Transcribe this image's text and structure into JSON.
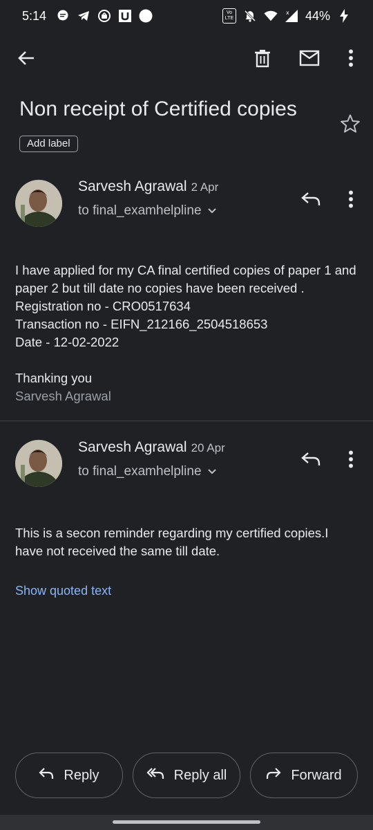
{
  "status_bar": {
    "time": "5:14",
    "battery": "44%",
    "lte_badge_top": "Vo",
    "lte_badge_bottom": "LTE"
  },
  "toolbar": {
    "back_icon": "arrow-left-icon",
    "delete_icon": "trash-icon",
    "mark_unread_icon": "mail-icon",
    "more_icon": "more-vert-icon"
  },
  "subject": "Non receipt of Certified copies",
  "add_label": "Add label",
  "messages": [
    {
      "sender": "Sarvesh Agrawal",
      "date": "2 Apr",
      "recipient": "to final_examhelpline",
      "body_lines": [
        "I have applied for my CA final certified copies of paper 1 and paper 2 but till date no copies have been received .",
        "Registration no - CRO0517634",
        "Transaction no - EIFN_212166_2504518653",
        "Date - 12-02-2022",
        "",
        "Thanking you"
      ],
      "signature": "Sarvesh Agrawal"
    },
    {
      "sender": "Sarvesh Agrawal",
      "date": "20 Apr",
      "recipient": "to final_examhelpline",
      "body_lines": [
        "This is a secon reminder regarding my certified copies.I have not received the same till date."
      ],
      "show_quoted": "Show quoted text"
    }
  ],
  "actions": {
    "reply": "Reply",
    "reply_all": "Reply all",
    "forward": "Forward"
  },
  "colors": {
    "background": "#202124",
    "link": "#8ab4f8"
  }
}
